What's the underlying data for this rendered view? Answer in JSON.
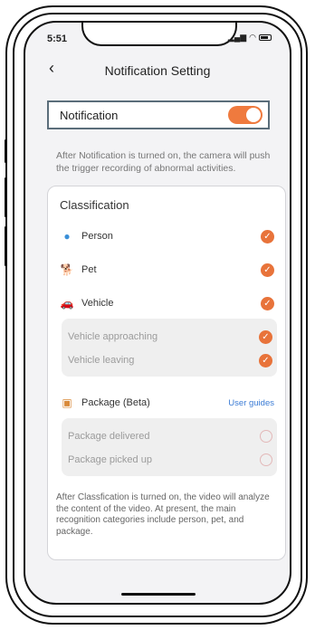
{
  "status": {
    "time": "5:51"
  },
  "header": {
    "title": "Notification Setting"
  },
  "notification": {
    "label": "Notification",
    "enabled": true,
    "description": "After Notification is turned on, the camera will push the trigger recording of abnormal activities."
  },
  "classification": {
    "title": "Classification",
    "items": [
      {
        "label": "Person",
        "checked": true,
        "icon": "person-icon"
      },
      {
        "label": "Pet",
        "checked": true,
        "icon": "pet-icon"
      },
      {
        "label": "Vehicle",
        "checked": true,
        "icon": "vehicle-icon"
      }
    ],
    "vehicle_sub": [
      {
        "label": "Vehicle approaching",
        "checked": true
      },
      {
        "label": "Vehicle leaving",
        "checked": true
      }
    ],
    "package": {
      "label": "Package (Beta)",
      "link": "User guides",
      "icon": "package-icon"
    },
    "package_sub": [
      {
        "label": "Package delivered",
        "checked": false
      },
      {
        "label": "Package picked up",
        "checked": false
      }
    ],
    "description": "After Classfication is turned on, the video will analyze the content of the video. At present, the main recognition categories include person, pet, and package."
  },
  "colors": {
    "accent": "#e8733a",
    "link": "#3a7bd5"
  }
}
